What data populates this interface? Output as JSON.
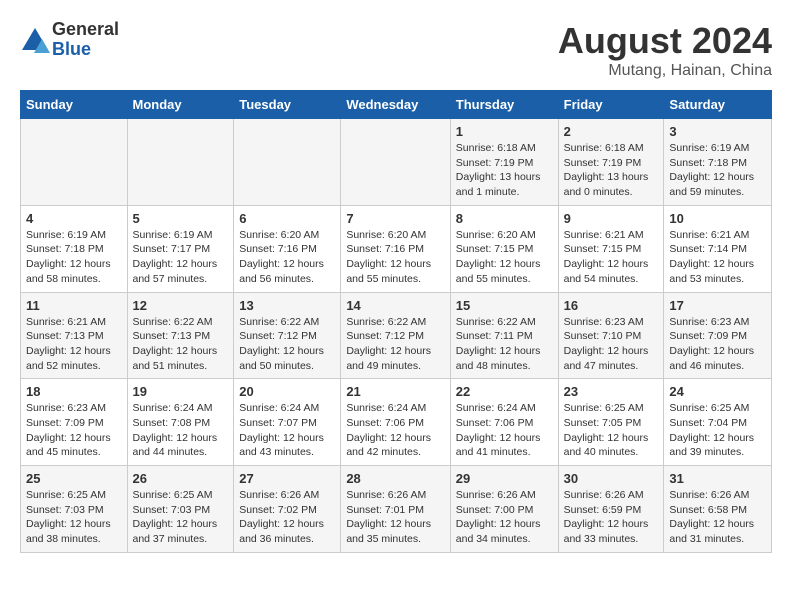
{
  "header": {
    "logo_general": "General",
    "logo_blue": "Blue",
    "month_title": "August 2024",
    "location": "Mutang, Hainan, China"
  },
  "weekdays": [
    "Sunday",
    "Monday",
    "Tuesday",
    "Wednesday",
    "Thursday",
    "Friday",
    "Saturday"
  ],
  "weeks": [
    [
      {
        "day": "",
        "info": ""
      },
      {
        "day": "",
        "info": ""
      },
      {
        "day": "",
        "info": ""
      },
      {
        "day": "",
        "info": ""
      },
      {
        "day": "1",
        "info": "Sunrise: 6:18 AM\nSunset: 7:19 PM\nDaylight: 13 hours\nand 1 minute."
      },
      {
        "day": "2",
        "info": "Sunrise: 6:18 AM\nSunset: 7:19 PM\nDaylight: 13 hours\nand 0 minutes."
      },
      {
        "day": "3",
        "info": "Sunrise: 6:19 AM\nSunset: 7:18 PM\nDaylight: 12 hours\nand 59 minutes."
      }
    ],
    [
      {
        "day": "4",
        "info": "Sunrise: 6:19 AM\nSunset: 7:18 PM\nDaylight: 12 hours\nand 58 minutes."
      },
      {
        "day": "5",
        "info": "Sunrise: 6:19 AM\nSunset: 7:17 PM\nDaylight: 12 hours\nand 57 minutes."
      },
      {
        "day": "6",
        "info": "Sunrise: 6:20 AM\nSunset: 7:16 PM\nDaylight: 12 hours\nand 56 minutes."
      },
      {
        "day": "7",
        "info": "Sunrise: 6:20 AM\nSunset: 7:16 PM\nDaylight: 12 hours\nand 55 minutes."
      },
      {
        "day": "8",
        "info": "Sunrise: 6:20 AM\nSunset: 7:15 PM\nDaylight: 12 hours\nand 55 minutes."
      },
      {
        "day": "9",
        "info": "Sunrise: 6:21 AM\nSunset: 7:15 PM\nDaylight: 12 hours\nand 54 minutes."
      },
      {
        "day": "10",
        "info": "Sunrise: 6:21 AM\nSunset: 7:14 PM\nDaylight: 12 hours\nand 53 minutes."
      }
    ],
    [
      {
        "day": "11",
        "info": "Sunrise: 6:21 AM\nSunset: 7:13 PM\nDaylight: 12 hours\nand 52 minutes."
      },
      {
        "day": "12",
        "info": "Sunrise: 6:22 AM\nSunset: 7:13 PM\nDaylight: 12 hours\nand 51 minutes."
      },
      {
        "day": "13",
        "info": "Sunrise: 6:22 AM\nSunset: 7:12 PM\nDaylight: 12 hours\nand 50 minutes."
      },
      {
        "day": "14",
        "info": "Sunrise: 6:22 AM\nSunset: 7:12 PM\nDaylight: 12 hours\nand 49 minutes."
      },
      {
        "day": "15",
        "info": "Sunrise: 6:22 AM\nSunset: 7:11 PM\nDaylight: 12 hours\nand 48 minutes."
      },
      {
        "day": "16",
        "info": "Sunrise: 6:23 AM\nSunset: 7:10 PM\nDaylight: 12 hours\nand 47 minutes."
      },
      {
        "day": "17",
        "info": "Sunrise: 6:23 AM\nSunset: 7:09 PM\nDaylight: 12 hours\nand 46 minutes."
      }
    ],
    [
      {
        "day": "18",
        "info": "Sunrise: 6:23 AM\nSunset: 7:09 PM\nDaylight: 12 hours\nand 45 minutes."
      },
      {
        "day": "19",
        "info": "Sunrise: 6:24 AM\nSunset: 7:08 PM\nDaylight: 12 hours\nand 44 minutes."
      },
      {
        "day": "20",
        "info": "Sunrise: 6:24 AM\nSunset: 7:07 PM\nDaylight: 12 hours\nand 43 minutes."
      },
      {
        "day": "21",
        "info": "Sunrise: 6:24 AM\nSunset: 7:06 PM\nDaylight: 12 hours\nand 42 minutes."
      },
      {
        "day": "22",
        "info": "Sunrise: 6:24 AM\nSunset: 7:06 PM\nDaylight: 12 hours\nand 41 minutes."
      },
      {
        "day": "23",
        "info": "Sunrise: 6:25 AM\nSunset: 7:05 PM\nDaylight: 12 hours\nand 40 minutes."
      },
      {
        "day": "24",
        "info": "Sunrise: 6:25 AM\nSunset: 7:04 PM\nDaylight: 12 hours\nand 39 minutes."
      }
    ],
    [
      {
        "day": "25",
        "info": "Sunrise: 6:25 AM\nSunset: 7:03 PM\nDaylight: 12 hours\nand 38 minutes."
      },
      {
        "day": "26",
        "info": "Sunrise: 6:25 AM\nSunset: 7:03 PM\nDaylight: 12 hours\nand 37 minutes."
      },
      {
        "day": "27",
        "info": "Sunrise: 6:26 AM\nSunset: 7:02 PM\nDaylight: 12 hours\nand 36 minutes."
      },
      {
        "day": "28",
        "info": "Sunrise: 6:26 AM\nSunset: 7:01 PM\nDaylight: 12 hours\nand 35 minutes."
      },
      {
        "day": "29",
        "info": "Sunrise: 6:26 AM\nSunset: 7:00 PM\nDaylight: 12 hours\nand 34 minutes."
      },
      {
        "day": "30",
        "info": "Sunrise: 6:26 AM\nSunset: 6:59 PM\nDaylight: 12 hours\nand 33 minutes."
      },
      {
        "day": "31",
        "info": "Sunrise: 6:26 AM\nSunset: 6:58 PM\nDaylight: 12 hours\nand 31 minutes."
      }
    ]
  ]
}
